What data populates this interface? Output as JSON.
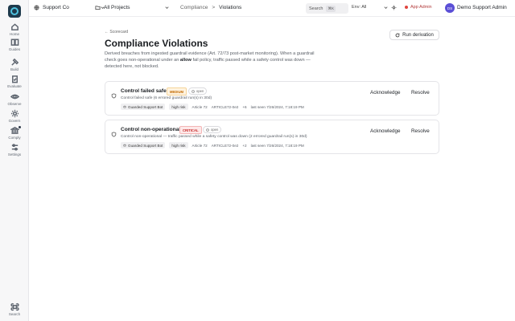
{
  "topbar": {
    "org_name": "Support Co",
    "project_name": "All Projects",
    "breadcrumbs": [
      "Compliance",
      ">",
      "Violations"
    ],
    "search_label": "Search",
    "search_shortcut": "⌘K",
    "env_label": "Env: All",
    "app_admin_label": "App Admin",
    "avatar_initials": "DS",
    "user_name": "Demo Support Admin"
  },
  "sidebar": {
    "items": [
      {
        "label": "Home",
        "icon": "home-icon"
      },
      {
        "label": "Guides",
        "icon": "book-icon"
      },
      {
        "label": "Build",
        "icon": "hammer-icon"
      },
      {
        "label": "Evaluate",
        "icon": "clipboard-check-icon"
      },
      {
        "label": "Observe",
        "icon": "eye-icon"
      },
      {
        "label": "Govern",
        "icon": "gear-icon"
      },
      {
        "label": "Comply",
        "icon": "bank-icon"
      },
      {
        "label": "Settings",
        "icon": "sliders-icon"
      }
    ],
    "search_label": "Search"
  },
  "page": {
    "back_label": "← Scorecard",
    "title": "Compliance Violations",
    "desc_part1": "Derived breaches from ingested guardrail evidence (Art. 72/73 post-market monitoring). When a guardrail check goes non-operational under an ",
    "desc_bold": "allow",
    "desc_part2": " fail policy, traffic passed while a safety control was down — detected here, not blocked.",
    "rerun_label": "Run derivation"
  },
  "violations": [
    {
      "title": "Control failed safe",
      "severity": "MEDIUM",
      "status": "open",
      "subtitle": "Control failed safe (6 errored guardrail run(s) in 30d)",
      "bot": "Guarded Support Bot",
      "risk": "high risk",
      "article": "Article 72",
      "article_id": "ARTICLE72-0e2",
      "extra": "+6",
      "last_seen": "last seen 7/26/2024, 7:18:19 PM",
      "ack_label": "Acknowledge",
      "resolve_label": "Resolve"
    },
    {
      "title": "Control non-operational",
      "severity": "CRITICAL",
      "status": "open",
      "subtitle": "Control non-operational — traffic passed while a safety control was down (2 errored guardrail run(s) in 30d)",
      "bot": "Guarded Support Bot",
      "risk": "high risk",
      "article": "Article 72",
      "article_id": "ARTICLE72-0e2",
      "extra": "+2",
      "last_seen": "last seen 7/26/2024, 7:18:19 PM",
      "ack_label": "Acknowledge",
      "resolve_label": "Resolve"
    }
  ],
  "colors": {
    "accent": "#5b4fd6",
    "admin_red": "#e0443e",
    "medium": "#c26a00",
    "critical": "#c62828"
  }
}
